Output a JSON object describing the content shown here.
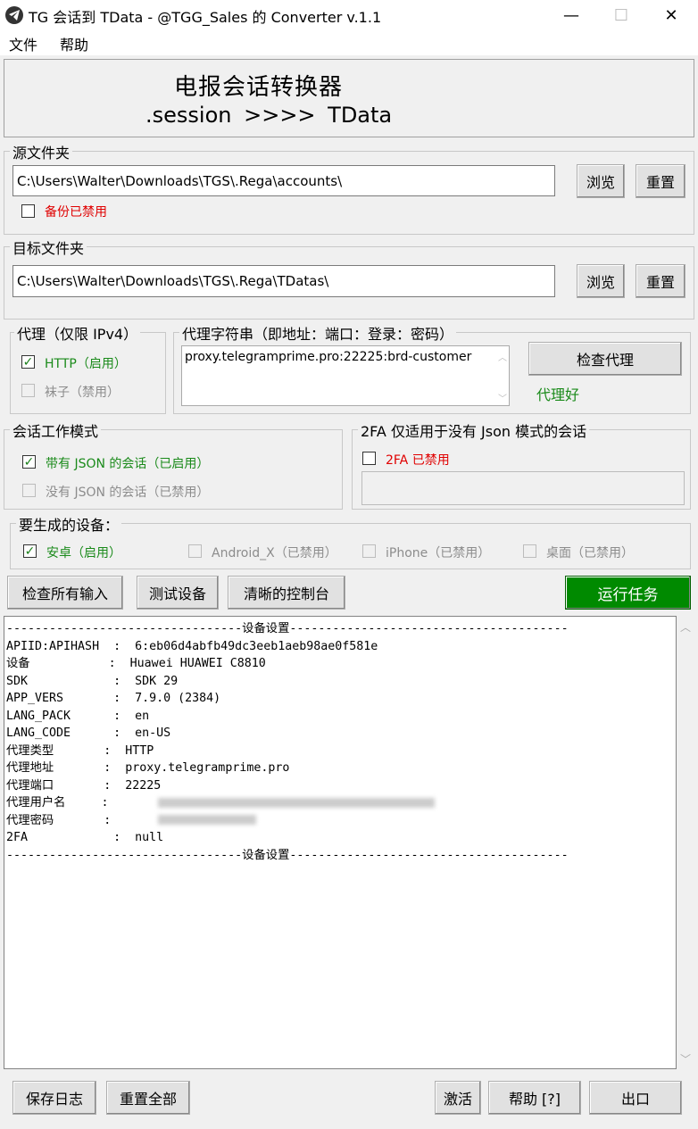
{
  "window": {
    "title": "TG 会话到 TData - @TGG_Sales 的 Converter v.1.1",
    "minimize": "—",
    "maximize": "☐",
    "close": "✕"
  },
  "menu": {
    "file": "文件",
    "help": "帮助"
  },
  "banner": {
    "title": "电报会话转换器",
    "subtitle": ".session >>>> TData"
  },
  "source": {
    "label": "源文件夹",
    "path": "C:\\Users\\Walter\\Downloads\\TGS\\.Rega\\accounts\\",
    "browse": "浏览",
    "reset": "重置",
    "backup_label": "备份已禁用",
    "backup_checked": false
  },
  "target": {
    "label": "目标文件夹",
    "path": "C:\\Users\\Walter\\Downloads\\TGS\\.Rega\\TDatas\\",
    "browse": "浏览",
    "reset": "重置"
  },
  "proxy": {
    "label": "代理（仅限 IPv4）",
    "http_label": "HTTP（启用）",
    "http_checked": true,
    "socks_label": "袜子（禁用）",
    "socks_checked": false,
    "string_label": "代理字符串（即地址：端口：登录：密码）",
    "string_value": "proxy.telegramprime.pro:22225:brd-customer",
    "check_button": "检查代理",
    "status": "代理好"
  },
  "session_mode": {
    "label": "会话工作模式",
    "json_label": "带有 JSON 的会话（已启用）",
    "json_checked": true,
    "nojson_label": "没有 JSON 的会话（已禁用）",
    "nojson_checked": false
  },
  "twofa": {
    "label": "2FA 仅适用于没有 Json 模式的会话",
    "checkbox_label": "2FA 已禁用",
    "checked": false,
    "value": ""
  },
  "devices": {
    "label": "要生成的设备：",
    "android_label": "安卓（启用）",
    "android_checked": true,
    "androidx_label": "Android_X（已禁用）",
    "iphone_label": "iPhone（已禁用）",
    "desktop_label": "桌面（已禁用）"
  },
  "actions": {
    "check_inputs": "检查所有输入",
    "test_device": "测试设备",
    "clear_console": "清晰的控制台",
    "run_task": "运行任务"
  },
  "console_lines": [
    "---------------------------------设备设置---------------------------------------",
    "APIID:APIHASH  :  6:eb06d4abfb49dc3eeb1aeb98ae0f581e",
    "设备           :  Huawei HUAWEI C8810",
    "SDK            :  SDK 29",
    "APP_VERS       :  7.9.0 (2384)",
    "LANG_PACK      :  en",
    "LANG_CODE      :  en-US",
    "代理类型       :  HTTP",
    "代理地址       :  proxy.telegramprime.pro",
    "代理端口       :  22225",
    "代理用户名     :  ",
    "代理密码       :  ",
    "2FA            :  null",
    "---------------------------------设备设置---------------------------------------"
  ],
  "bottom": {
    "save_log": "保存日志",
    "reset_all": "重置全部",
    "activate": "激活",
    "help": "帮助 [?]",
    "exit": "出口"
  },
  "colors": {
    "run_button": "#008a00",
    "status_green": "#1a8a1a",
    "disabled_red": "#e00000"
  }
}
